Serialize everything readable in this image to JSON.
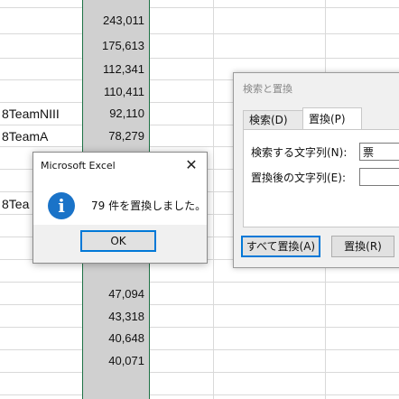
{
  "sheet": {
    "values": [
      "243,011",
      "175,613",
      "112,341",
      "110,411",
      "92,110",
      "78,279",
      "47,094",
      "43,318",
      "40,648",
      "40,071"
    ],
    "teams": [
      "8TeamNIII",
      "8TeamA",
      "8Tea"
    ]
  },
  "find_replace": {
    "title": "検索と置換",
    "tabs": [
      "検索(D)",
      "置換(P)"
    ],
    "find_label": "検索する文字列(N):",
    "find_value": "票",
    "replace_label": "置換後の文字列(E):",
    "replace_value": "",
    "replace_all_label": "すべて置換(A)",
    "replace_label_btn": "置換(R)"
  },
  "message_box": {
    "title": "Microsoft Excel",
    "close_glyph": "✕",
    "icon_glyph": "i",
    "message": "79 件を置換しました。",
    "ok_label": "OK"
  },
  "colors": {
    "selection_fill": "#d0d0d0",
    "selection_border": "#1e7145",
    "accent": "#0078d7",
    "info_icon": "#1a73c8"
  }
}
